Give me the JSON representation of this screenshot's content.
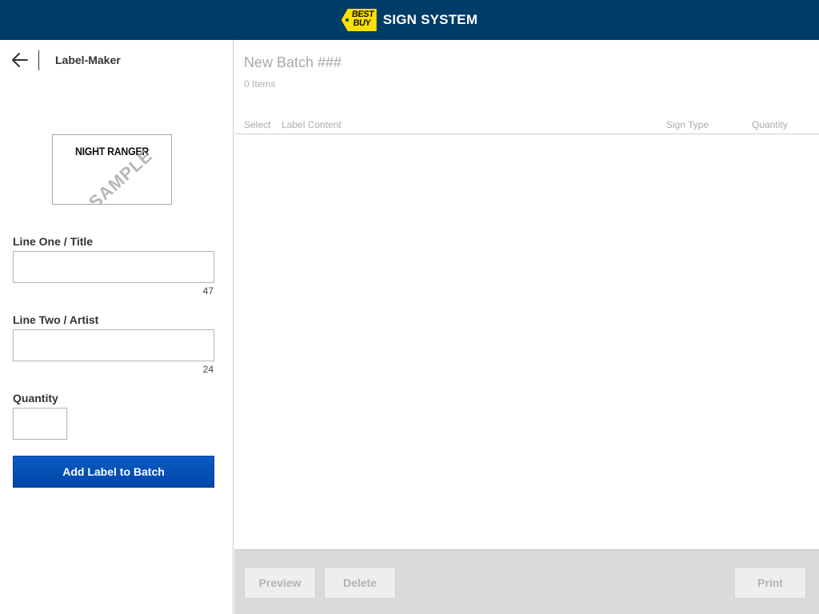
{
  "header": {
    "logo_text": "BEST BUY",
    "app_title": "SIGN SYSTEM",
    "colors": {
      "bar": "#003c68",
      "logo": "#ffe000"
    }
  },
  "left_panel": {
    "back_icon": "arrow-left-icon",
    "title": "Label-Maker",
    "preview": {
      "title": "NIGHT RANGER",
      "watermark": "SAMPLE"
    },
    "line_one": {
      "label": "Line One / Title",
      "value": "",
      "placeholder": "",
      "counter": "47"
    },
    "line_two": {
      "label": "Line Two / Artist",
      "value": "",
      "placeholder": "",
      "counter": "24"
    },
    "quantity": {
      "label": "Quantity",
      "value": ""
    },
    "add_button": "Add Label to Batch",
    "accent": "#0050b8"
  },
  "batch": {
    "title": "New Batch ###",
    "item_count": "0 Items",
    "columns": [
      "Select",
      "Label Content",
      "Sign Type",
      "Quantity"
    ],
    "rows": []
  },
  "footer": {
    "preview_button": "Preview",
    "delete_button": "Delete",
    "print_button": "Print"
  }
}
